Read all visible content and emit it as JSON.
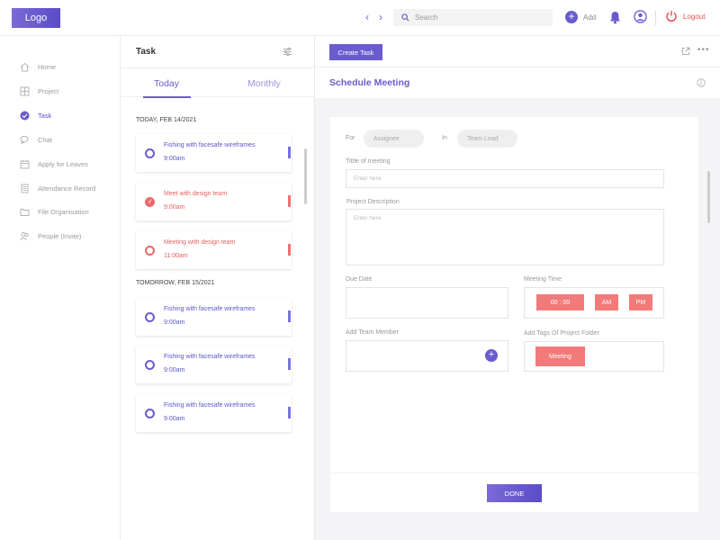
{
  "header": {
    "logo": "Logo",
    "search_placeholder": "Search",
    "add_label": "Add",
    "logout_label": "Logout"
  },
  "sidebar": {
    "items": [
      {
        "label": "Home",
        "icon": "home-icon"
      },
      {
        "label": "Project",
        "icon": "grid-icon"
      },
      {
        "label": "Task",
        "icon": "check-circle-icon",
        "active": true
      },
      {
        "label": "Chat",
        "icon": "chat-icon"
      },
      {
        "label": "Apply for Leaves",
        "icon": "calendar-icon"
      },
      {
        "label": "Attendance Record",
        "icon": "document-icon"
      },
      {
        "label": "File Organisation",
        "icon": "folder-icon"
      },
      {
        "label": "People (Invite)",
        "icon": "people-icon"
      }
    ]
  },
  "tasks": {
    "title": "Task",
    "tabs": {
      "today": "Today",
      "monthly": "Monthly"
    },
    "groups": [
      {
        "heading": "TODAY, FEB 14/2021",
        "items": [
          {
            "name": "Fishing with facesafe wireframes",
            "time": "9:00am",
            "status": "open",
            "color": "#6a5ccf"
          },
          {
            "name": "Meet with design team",
            "time": "9:00am",
            "status": "done",
            "color": "#e96a6a"
          },
          {
            "name": "Meeting with design team",
            "time": "11:00am",
            "status": "open",
            "color": "#e96a6a"
          }
        ]
      },
      {
        "heading": "TOMORROW, FEB 15/2021",
        "items": [
          {
            "name": "Fishing with facesafe wireframes",
            "time": "9:00am",
            "status": "open",
            "color": "#6a5ccf"
          },
          {
            "name": "Fishing with facesafe wireframes",
            "time": "9:00am",
            "status": "open",
            "color": "#6a5ccf"
          },
          {
            "name": "Fishing with facesafe wireframes",
            "time": "9:00am",
            "status": "open",
            "color": "#6a5ccf"
          }
        ]
      }
    ]
  },
  "main": {
    "create_task": "Create Task",
    "schedule_title": "Schedule Meeting",
    "form": {
      "for_label": "For",
      "assignee_placeholder": "Assignee",
      "in_label": "In",
      "team_lead_placeholder": "Team Lead",
      "title_label": "Tittle of meeting",
      "title_placeholder": "Enter here",
      "desc_label": "Project Description",
      "desc_placeholder": "Enter here",
      "due_date_label": "Due Date",
      "meeting_time_label": "Meeting Time",
      "time_value": "00 : 00",
      "am_label": "AM",
      "pm_label": "PM",
      "team_member_label": "Add Team Member",
      "tags_label": "Add Tags Of Project Folder",
      "tag_value": "Meeting"
    },
    "done_label": "DONE"
  },
  "colors": {
    "accent": "#6a5ccf",
    "danger": "#e96a6a",
    "background": "#f4f4f6"
  }
}
